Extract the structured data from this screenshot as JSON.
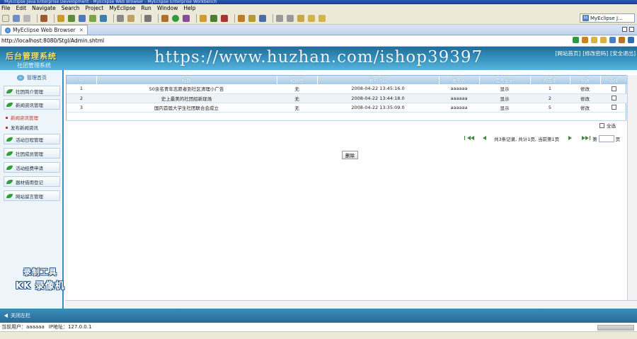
{
  "window": {
    "title": "MyEclipse Java Enterprise Development - MyEclipse Web Browser - MyEclipse Enterprise Workbench"
  },
  "menu": [
    "File",
    "Edit",
    "Navigate",
    "Search",
    "Project",
    "MyEclipse",
    "Run",
    "Window",
    "Help"
  ],
  "perspective": {
    "label": "MyEclipse J..."
  },
  "browser_tab": {
    "label": "MyEclipse Web Browser",
    "close": "✕"
  },
  "address": {
    "value": "http://localhost:8080/Stgl/Admin.shtml"
  },
  "app": {
    "logo": "后台管理系统",
    "system_name": "社团管理系统",
    "links": [
      "[网站首页]",
      "[修改密码]",
      "[安全退出]"
    ]
  },
  "watermark": "https://www.huzhan.com/ishop39397",
  "sidebar": {
    "top": "管理首页",
    "items": [
      "社团简介管理",
      "新闻资讯管理",
      "活动日程管理",
      "社团成员管理",
      "活动经费申请",
      "器材借用登记",
      "网站留言管理"
    ],
    "subs": [
      "新闻资讯管理",
      "发布新闻资讯"
    ]
  },
  "grid": {
    "headers": [
      "ID",
      "标题",
      "缩略图",
      "发布时间",
      "发布人",
      "是否显示",
      "点击率",
      "修改",
      "选择"
    ],
    "rows": [
      [
        "1",
        "50余名青年志愿者到社区清理小广告",
        "无",
        "2008-04-22 13:45:16.0",
        "aaaaaa",
        "显示",
        "1",
        "修改"
      ],
      [
        "2",
        "史上最美的社团招新现场",
        "无",
        "2008-04-22 13:44:18.0",
        "aaaaaa",
        "显示",
        "2",
        "修改"
      ],
      [
        "3",
        "国内首届大学生社团联合会成立",
        "无",
        "2008-04-22 13:35:09.0",
        "aaaaaa",
        "显示",
        "5",
        "修改"
      ]
    ],
    "select_all": "全选"
  },
  "pager": {
    "info": "共3条记录, 共计1页, 当前第1页",
    "page_prefix": "第",
    "page_suffix": "页"
  },
  "delete_label": "删除",
  "recorder": {
    "line1": "录制工具",
    "line2": "KK 录像机"
  },
  "footer": {
    "close_left": "关闭左栏"
  },
  "status": {
    "user": "当前用户：aaaaaa",
    "ip": "IP地址：127.0.0.1"
  }
}
